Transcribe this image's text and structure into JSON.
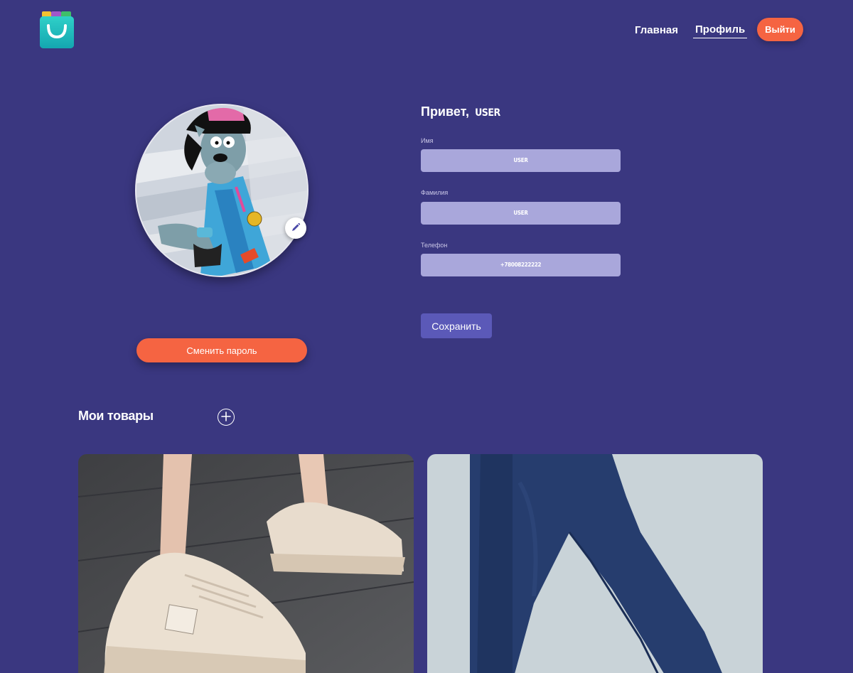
{
  "header": {
    "logo_icon": "shopping-bag-logo-icon",
    "nav": [
      {
        "label": "Главная",
        "active": false
      },
      {
        "label": "Профиль",
        "active": true
      }
    ],
    "logout_label": "Выйти"
  },
  "profile": {
    "avatar_icon": "avatar-image",
    "edit_icon": "pencil-icon",
    "change_password_label": "Сменить пароль",
    "greeting": "Привет,",
    "username": "USER",
    "fields": [
      {
        "label": "Имя",
        "value": "USER"
      },
      {
        "label": "Фамилия",
        "value": "USER"
      },
      {
        "label": "Телефон",
        "value": "+78008222222"
      }
    ],
    "save_label": "Сохранить"
  },
  "products": {
    "title": "Мои товары",
    "add_icon": "plus-circle-icon",
    "items": [
      {
        "image": "sneakers-product-image"
      },
      {
        "image": "jeans-product-image"
      }
    ]
  },
  "colors": {
    "background": "#3a3780",
    "accent": "#f56442",
    "input_bg": "#a9a7db",
    "save_button": "#5b59b8"
  }
}
